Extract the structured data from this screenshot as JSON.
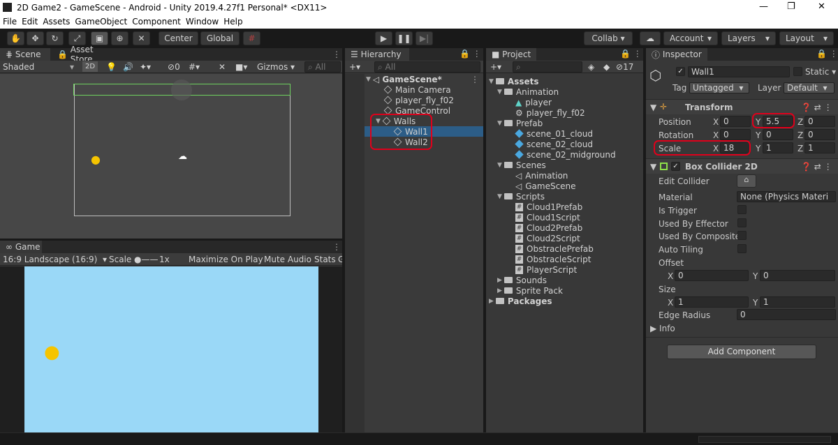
{
  "window": {
    "title": "2D Game2 - GameScene - Android - Unity 2019.4.27f1 Personal* <DX11>",
    "minimize": "—",
    "restore": "❐",
    "close": "✕"
  },
  "menu": [
    "File",
    "Edit",
    "Assets",
    "GameObject",
    "Component",
    "Window",
    "Help"
  ],
  "toolbar": {
    "center": "Center",
    "global": "Global",
    "collab": "Collab ▾",
    "account": "Account",
    "layers": "Layers",
    "layout": "Layout"
  },
  "scene": {
    "tab_scene": "Scene",
    "tab_asset_store": "Asset Store",
    "shading": "Shaded",
    "mode_2d": "2D",
    "hidden_count": "0",
    "gizmos": "Gizmos",
    "search_placeholder": "All"
  },
  "game": {
    "tab": "Game",
    "aspect": "16:9 Landscape (16:9)",
    "scale_label": "Scale",
    "scale_value": "1x",
    "maximize": "Maximize On Play",
    "mute": "Mute Audio",
    "stats": "Stats",
    "gizmos_cut": "G"
  },
  "hierarchy": {
    "tab": "Hierarchy",
    "search_placeholder": "All",
    "scene": "GameScene*",
    "items": [
      "Main Camera",
      "player_fly_f02",
      "GameControl",
      "Walls",
      "Wall1",
      "Wall2"
    ]
  },
  "project": {
    "tab": "Project",
    "count": "17",
    "assets": "Assets",
    "animation": "Animation",
    "animation_items": [
      "player",
      "player_fly_f02"
    ],
    "prefab": "Prefab",
    "prefab_items": [
      "scene_01_cloud",
      "scene_02_cloud",
      "scene_02_midground"
    ],
    "scenes": "Scenes",
    "scenes_items": [
      "Animation",
      "GameScene"
    ],
    "scripts": "Scripts",
    "script_items": [
      "Cloud1Prefab",
      "Cloud1Script",
      "Cloud2Prefab",
      "Cloud2Script",
      "ObstraclePrefab",
      "ObstracleScript",
      "PlayerScript"
    ],
    "sounds": "Sounds",
    "sprite_pack": "Sprite Pack",
    "packages": "Packages"
  },
  "inspector": {
    "tab": "Inspector",
    "object_name": "Wall1",
    "static_label": "Static ▾",
    "tag_label": "Tag",
    "tag_value": "Untagged",
    "layer_label": "Layer",
    "layer_value": "Default",
    "transform": {
      "title": "Transform",
      "position_label": "Position",
      "pos_x": "0",
      "pos_y": "5.5",
      "pos_z": "0",
      "rotation_label": "Rotation",
      "rot_x": "0",
      "rot_y": "0",
      "rot_z": "0",
      "scale_label": "Scale",
      "scale_x": "18",
      "scale_y": "1",
      "scale_z": "1"
    },
    "collider": {
      "title": "Box Collider 2D",
      "edit_collider": "Edit Collider",
      "material_label": "Material",
      "material_value": "None (Physics Materi",
      "is_trigger": "Is Trigger",
      "used_by_effector": "Used By Effector",
      "used_by_composite": "Used By Composite",
      "auto_tiling": "Auto Tiling",
      "offset_label": "Offset",
      "offset_x": "0",
      "offset_y": "0",
      "size_label": "Size",
      "size_x": "1",
      "size_y": "1",
      "edge_radius_label": "Edge Radius",
      "edge_radius": "0"
    },
    "info": "Info",
    "add_component": "Add Component"
  },
  "axis": {
    "x": "X",
    "y": "Y",
    "z": "Z"
  },
  "colors": {
    "selection": "#2c5d87",
    "highlight": "#e0001b",
    "game_sky": "#9ad8f7"
  }
}
